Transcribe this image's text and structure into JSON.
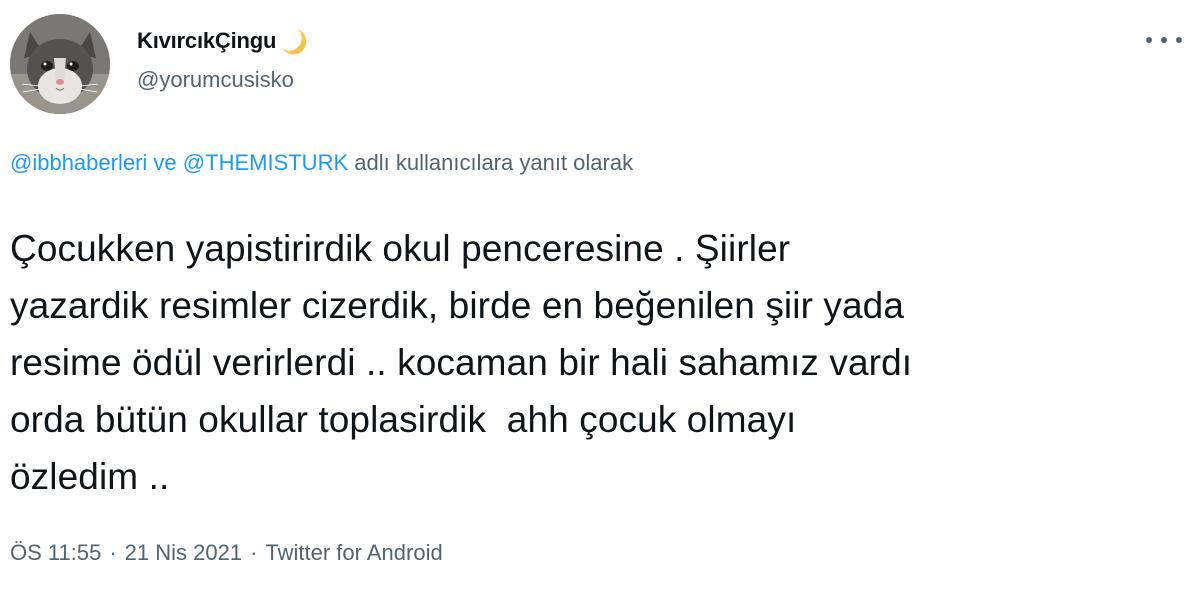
{
  "author": {
    "display_name": "KıvırcıkÇingu",
    "emoji_icon": "crescent-moon-icon",
    "handle": "@yorumcusisko",
    "avatar": "cat-avatar"
  },
  "reply_context": {
    "user1": "@ibbhaberleri",
    "connector": "ve",
    "user2": "@THEMISTURK",
    "suffix": "adlı kullanıcılara yanıt olarak"
  },
  "tweet": {
    "lines": [
      "Çocukken yapistirirdik okul penceresine . Şiirler",
      "yazardik resimler cizerdik, birde en beğenilen şiir yada",
      "resime ödül verirlerdi .. kocaman bir hali sahamız vardı",
      "orda bütün okullar toplasirdik  ahh çocuk olmayı",
      "özledim .."
    ]
  },
  "meta": {
    "time": "ÖS 11:55",
    "date": "21 Nis 2021",
    "source": "Twitter for Android",
    "separator": "·"
  },
  "colors": {
    "text": "#0f1419",
    "secondary": "#536471",
    "link": "#1d9bf0"
  }
}
